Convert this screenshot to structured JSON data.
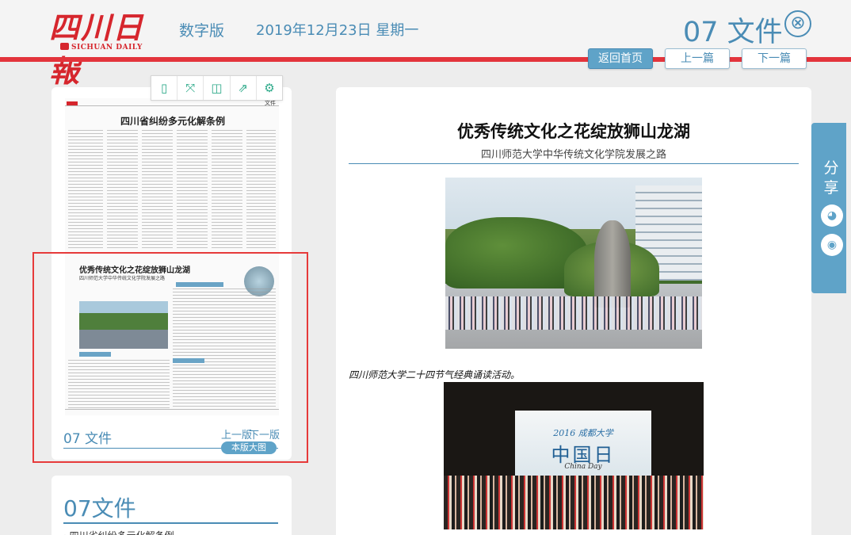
{
  "header": {
    "logo_text": "四川日報",
    "logo_sub": "SICHUAN DAILY",
    "edition": "数字版",
    "date": "2019年12月23日 星期一",
    "page_title": "07 文件",
    "close_icon": "⊗"
  },
  "nav": {
    "home": "返回首页",
    "prev": "上一篇",
    "next": "下一篇"
  },
  "toolbar": {
    "icons": [
      "pdf-icon",
      "fullscreen-icon",
      "save-icon",
      "share-out-icon",
      "settings-icon"
    ],
    "glyphs": [
      "▯",
      "⤧",
      "◫",
      "⇗",
      "⚙"
    ]
  },
  "thumbnail": {
    "page_tag": "文件",
    "headline_top": "四川省纠纷多元化解条例",
    "headline_main": "优秀传统文化之花绽放狮山龙湖",
    "headline_sub": "四川师范大学中华传统文化学院发展之路",
    "caption": "07 文件",
    "prev_page": "上一版",
    "next_page": "下一版",
    "page_image_button": "本版大图"
  },
  "list": {
    "title": "07文件",
    "first_item": "· 四川省纠纷多元化解条例"
  },
  "article": {
    "title": "优秀传统文化之花绽放狮山龙湖",
    "subtitle": "四川师范大学中华传统文化学院发展之路",
    "photo_caption": "四川师范大学二十四节气经典诵读活动。",
    "photo2_banner_top": "2016 成都大学",
    "photo2_banner_main": "中国日",
    "photo2_banner_en": "China Day"
  },
  "share": {
    "label": "分享",
    "wechat_icon": "wechat-icon",
    "weibo_icon": "weibo-icon",
    "wechat_glyph": "◕",
    "weibo_glyph": "◉"
  },
  "colors": {
    "accent": "#4a8cb5",
    "brand_red": "#d6262d",
    "share_bg": "#5fa3c8",
    "highlight": "#e63a3a"
  }
}
